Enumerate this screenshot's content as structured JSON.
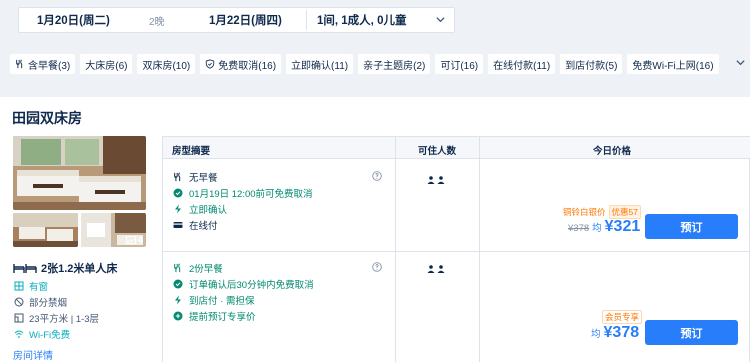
{
  "search": {
    "checkin": "1月20日(周二)",
    "nights": "2晚",
    "checkout": "1月22日(周四)",
    "guests": "1间, 1成人, 0儿童"
  },
  "filters": [
    {
      "label": "含早餐(3)",
      "icon": "utensils-icon"
    },
    {
      "label": "大床房(6)",
      "icon": ""
    },
    {
      "label": "双床房(10)",
      "icon": ""
    },
    {
      "label": "免费取消(16)",
      "icon": "shield-check-icon"
    },
    {
      "label": "立即确认(11)",
      "icon": ""
    },
    {
      "label": "亲子主题房(2)",
      "icon": ""
    },
    {
      "label": "可订(16)",
      "icon": ""
    },
    {
      "label": "在线付款(11)",
      "icon": ""
    },
    {
      "label": "到店付款(5)",
      "icon": ""
    },
    {
      "label": "免费Wi-Fi上网(16)",
      "icon": ""
    }
  ],
  "room": {
    "title": "田园双床房",
    "photo_count": "4",
    "bed": "2张1.2米单人床",
    "features": [
      "有窗",
      "部分禁烟",
      "23平方米 | 1-3层",
      "Wi-Fi免费"
    ],
    "details_link": "房间详情"
  },
  "table": {
    "headers": {
      "summary": "房型摘要",
      "occupancy": "可住人数",
      "price": "今日价格"
    }
  },
  "offers": [
    {
      "items": [
        "无早餐",
        "01月19日 12:00前可免费取消",
        "立即确认",
        "在线付"
      ],
      "badge1": "铜铃白银价",
      "badge2": "优惠57",
      "original_price": "¥378",
      "avg_label": "均",
      "price": "¥321",
      "book": "预订"
    },
    {
      "items": [
        "2份早餐",
        "订单确认后30分钟内免费取消",
        "到店付 · 需担保",
        "提前预订专享价"
      ],
      "badge1": "会员专享",
      "avg_label": "均",
      "price": "¥378",
      "book": "预订"
    }
  ],
  "colors": {
    "accent": "#287dfa",
    "green": "#008a70",
    "orange": "#ff7700",
    "text": "#0f294d"
  }
}
